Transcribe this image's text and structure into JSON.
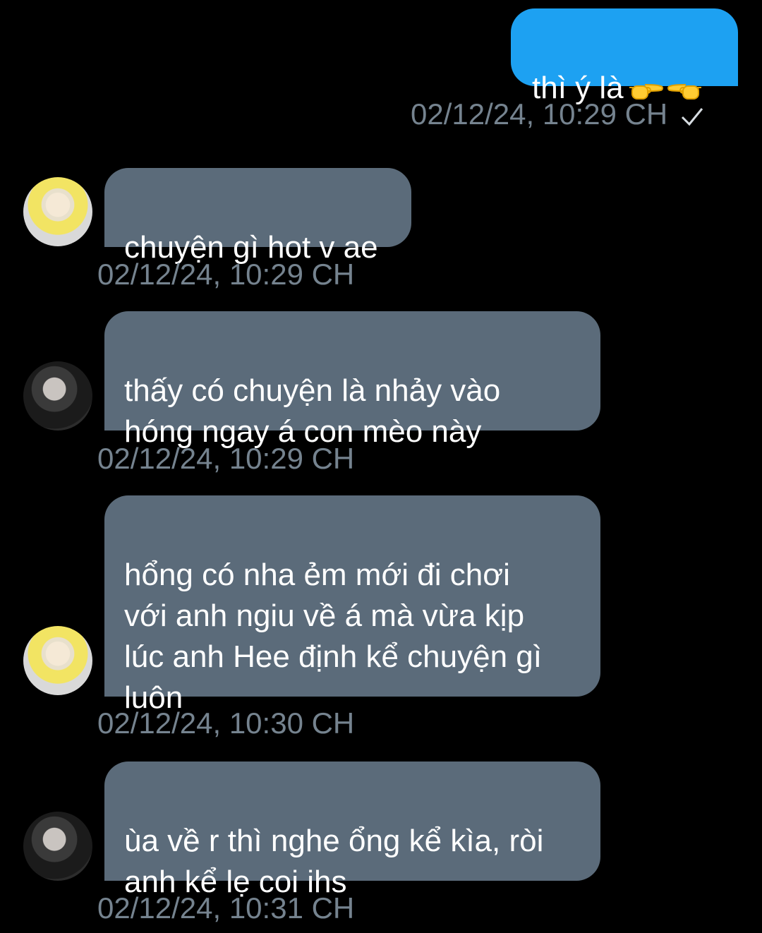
{
  "messages": [
    {
      "direction": "outgoing",
      "text": "thì ý là",
      "emojis": [
        "backhand-index-pointing-right-icon",
        "backhand-index-pointing-left-icon"
      ],
      "timestamp": "02/12/24, 10:29 CH",
      "status_icon": "checkmark-icon"
    },
    {
      "direction": "incoming",
      "avatar": "avatar-yellow-hood",
      "text": "chuyện gì hot v ae",
      "timestamp": "02/12/24, 10:29 CH"
    },
    {
      "direction": "incoming",
      "avatar": "avatar-glasses",
      "text": "thấy có chuyện là nhảy vào\nhóng ngay á con mèo này",
      "timestamp": "02/12/24, 10:29 CH"
    },
    {
      "direction": "incoming",
      "avatar": "avatar-yellow-hood",
      "text": "hổng có nha ẻm mới đi chơi\nvới anh ngiu về á mà vừa kịp\nlúc anh Hee định kể chuyện gì\nluôn",
      "timestamp": "02/12/24, 10:30 CH"
    },
    {
      "direction": "incoming",
      "avatar": "avatar-glasses",
      "text": "ùa về r thì nghe ổng kể kìa, ròi\nanh kể lẹ coi ihs",
      "timestamp": "02/12/24, 10:31 CH"
    }
  ],
  "colors": {
    "background": "#000000",
    "outgoing_bubble": "#1da1f2",
    "incoming_bubble": "#5b6b7a",
    "timestamp": "#75838f"
  }
}
